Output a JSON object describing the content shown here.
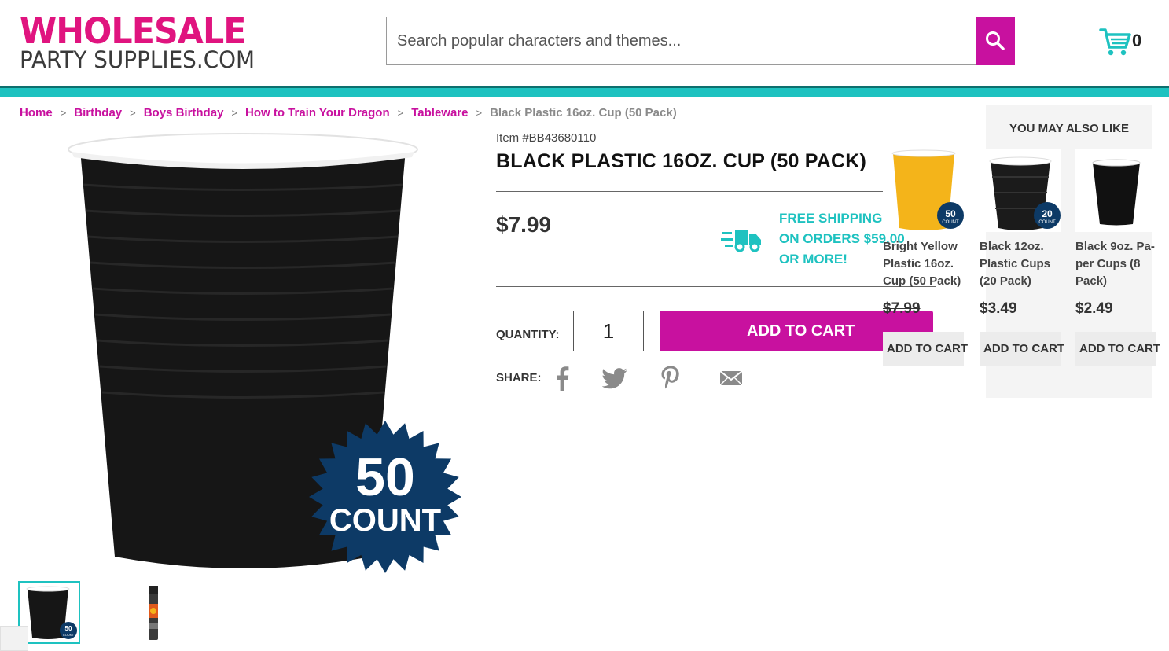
{
  "header": {
    "logo_top": "WHOLESALE",
    "logo_bottom": "PARTY SUPPLIES.COM",
    "search_placeholder": "Search popular characters and themes...",
    "cart_count": "0"
  },
  "breadcrumb": [
    {
      "label": "Home"
    },
    {
      "label": "Birthday"
    },
    {
      "label": "Boys Birthday"
    },
    {
      "label": "How to Train Your Dragon"
    },
    {
      "label": "Tableware"
    },
    {
      "label": "Black Plastic 16oz. Cup (50 Pack)"
    }
  ],
  "product": {
    "item_number": "Item #BB43680110",
    "title": "BLACK PLASTIC 16OZ. CUP (50 PACK)",
    "price": "$7.99",
    "shipping_text": "FREE SHIPPING ON ORDERS $59.00 OR MORE!",
    "quantity_label": "QUANTITY:",
    "quantity_value": "1",
    "add_to_cart": "ADD TO CART",
    "share_label": "SHARE:",
    "badge_number": "50",
    "badge_word": "COUNT"
  },
  "share_icons": [
    "facebook-icon",
    "twitter-icon",
    "pinterest-icon",
    "email-icon"
  ],
  "ymal": {
    "title": "YOU MAY ALSO LIKE",
    "items": [
      {
        "name": "Bright Yellow Plastic 16oz. Cup (50 Pack)",
        "price": "$7.99",
        "button": "ADD TO CART",
        "badge": "50",
        "badge_word": "COUNT",
        "cup_color": "#f4b41a"
      },
      {
        "name": "Black 12oz. Plastic Cups (20 Pack)",
        "price": "$3.49",
        "button": "ADD TO CART",
        "badge": "20",
        "badge_word": "COUNT",
        "cup_color": "#1b1b1b"
      },
      {
        "name": "Black 9oz. Pa-per Cups (8 Pack)",
        "price": "$2.49",
        "button": "ADD TO CART",
        "badge": "",
        "badge_word": "",
        "cup_color": "#111111"
      }
    ]
  },
  "colors": {
    "brand_magenta": "#c8119f",
    "logo_pink": "#e0147f",
    "teal": "#1ec2c0",
    "badge_navy": "#0d3a66"
  }
}
